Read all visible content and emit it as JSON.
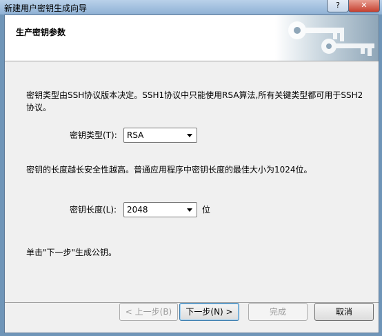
{
  "window": {
    "title": "新建用户密钥生成向导",
    "help_label": "?",
    "close_label": "✕"
  },
  "header": {
    "title": "生产密钥参数"
  },
  "content": {
    "intro_line1": "密钥类型由SSH协议版本决定。SSH1协议中只能使用RSA算法,所有关键类型都可用于SSH2",
    "intro_line2": "协议。",
    "key_type_label": "密钥类型(T):",
    "key_type_value": "RSA",
    "length_note": "密钥的长度越长安全性越高。普通应用程序中密钥长度的最佳大小为1024位。",
    "key_length_label": "密钥长度(L):",
    "key_length_value": "2048",
    "key_length_unit": "位",
    "next_hint": "单击\"下一步\"生成公钥。"
  },
  "buttons": {
    "back": "< 上一步(B)",
    "next": "下一步(N) >",
    "finish": "完成",
    "cancel": "取消"
  }
}
